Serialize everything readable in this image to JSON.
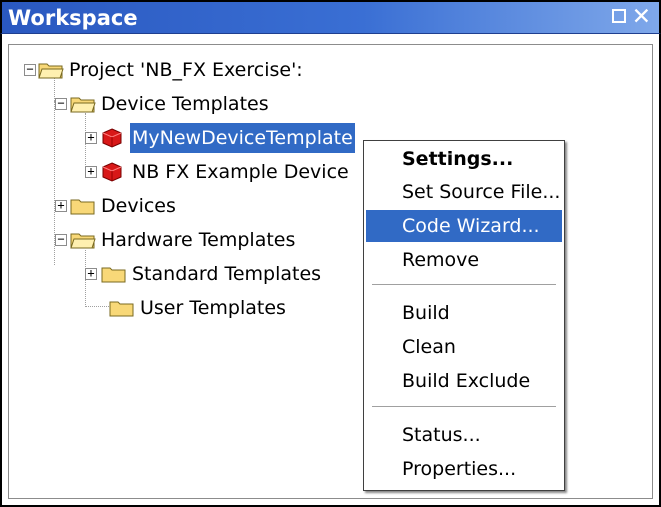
{
  "window": {
    "title": "Workspace"
  },
  "tree": {
    "project": "Project 'NB_FX Exercise':",
    "device_templates": "Device Templates",
    "my_new_device_template": "MyNewDeviceTemplate",
    "nb_fx_example_device": "NB FX Example Device",
    "devices": "Devices",
    "hardware_templates": "Hardware Templates",
    "standard_templates": "Standard Templates",
    "user_templates": "User Templates"
  },
  "context_menu": {
    "settings": "Settings...",
    "set_source_file": "Set Source File...",
    "code_wizard": "Code Wizard...",
    "remove": "Remove",
    "build": "Build",
    "clean": "Clean",
    "build_exclude": "Build Exclude",
    "status": "Status...",
    "properties": "Properties..."
  },
  "colors": {
    "titlebar": "#2a58c0",
    "selection": "#316ac5",
    "folder": "#f8d878",
    "cube": "#d81818"
  }
}
